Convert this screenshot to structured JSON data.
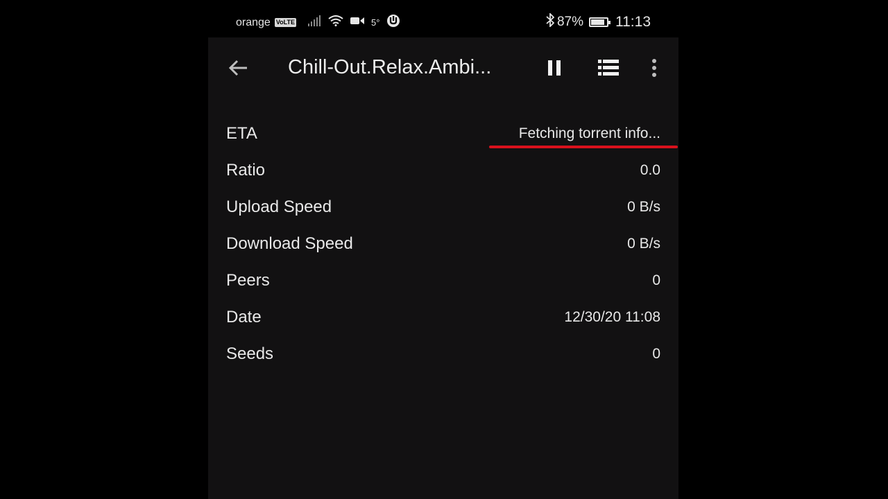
{
  "status_bar": {
    "carrier": "orange",
    "volte": "VoLTE",
    "temperature": "5°",
    "battery_percent": "87%",
    "battery_level": 0.87,
    "time": "11:13"
  },
  "toolbar": {
    "title": "Chill-Out.Relax.Ambi..."
  },
  "details": [
    {
      "label": "ETA",
      "value": "Fetching torrent info..."
    },
    {
      "label": "Ratio",
      "value": "0.0"
    },
    {
      "label": "Upload Speed",
      "value": "0 B/s"
    },
    {
      "label": "Download Speed",
      "value": "0 B/s"
    },
    {
      "label": "Peers",
      "value": "0"
    },
    {
      "label": "Date",
      "value": "12/30/20 11:08"
    },
    {
      "label": "Seeds",
      "value": "0"
    }
  ],
  "colors": {
    "background": "#121112",
    "highlight": "#d8111c"
  }
}
